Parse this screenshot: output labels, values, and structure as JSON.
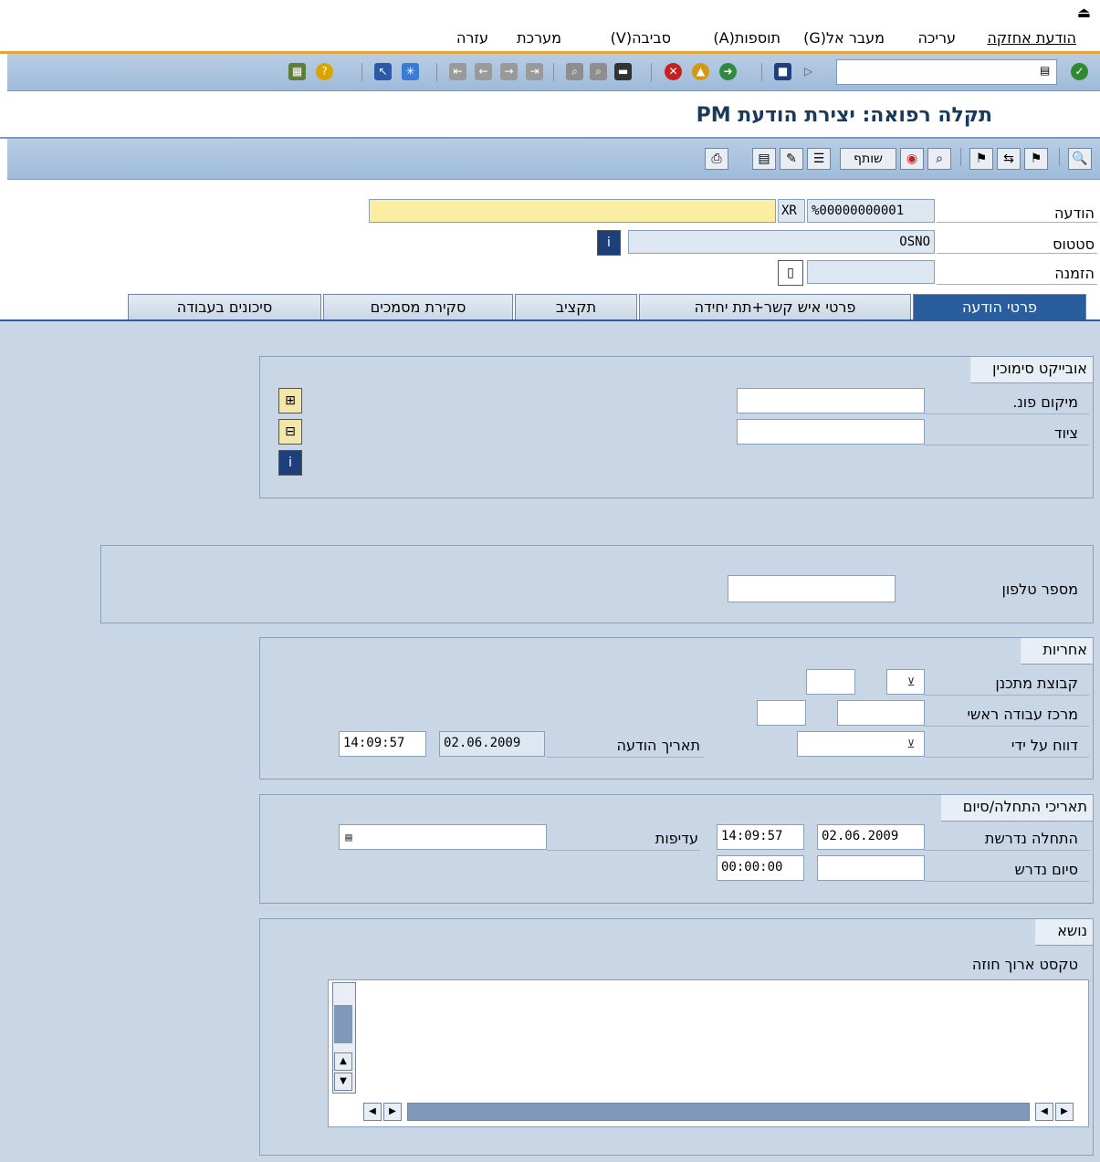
{
  "menu": {
    "items": [
      "הודעת אחזקה",
      "עריכה",
      "מעבר אל(G)",
      "תוספות(A)",
      "סביבה(V)",
      "מערכת",
      "עזרה"
    ],
    "exit_glyph": "⏏"
  },
  "toolbar": {
    "command_value": ""
  },
  "title": {
    "text": "תקלה רפואה: יצירת הודעת PM"
  },
  "app_toolbar": {
    "partner_label": "שותף"
  },
  "header": {
    "notification_label": "הודעה",
    "notification_number": "%00000000001",
    "notification_type": "XR",
    "notification_desc": "",
    "status_label": "סטטוס",
    "status_value": "OSNO",
    "order_label": "הזמנה",
    "order_value": ""
  },
  "tabs": [
    {
      "label": "פרטי הודעה",
      "active": true
    },
    {
      "label": "פרטי איש קשר+תת יחידה",
      "active": false
    },
    {
      "label": "תקציב",
      "active": false
    },
    {
      "label": "סקירת מסמכים",
      "active": false
    },
    {
      "label": "סיכונים בעבודה",
      "active": false
    }
  ],
  "reference_object": {
    "title": "אובייקט סימוכין",
    "func_loc_label": "מיקום פונ.",
    "func_loc_value": "",
    "equipment_label": "ציוד",
    "equipment_value": ""
  },
  "phone": {
    "label": "מספר טלפון",
    "value": ""
  },
  "responsibility": {
    "title": "אחריות",
    "planner_group_label": "קבוצת מתכנן",
    "main_workcenter_label": "מרכז עבודה ראשי",
    "reported_by_label": "דווח על ידי",
    "notif_date_label": "תאריך הודעה",
    "notif_date": "02.06.2009",
    "notif_time": "14:09:57"
  },
  "dates": {
    "title": "תאריכי התחלה/סיום",
    "req_start_label": "התחלה נדרשת",
    "req_start_date": "02.06.2009",
    "req_start_time": "14:09:57",
    "req_end_label": "סיום נדרש",
    "req_end_date": "",
    "req_end_time": "00:00:00",
    "priority_label": "עדיפות",
    "priority_value": ""
  },
  "subject": {
    "title": "נושא",
    "long_text_label": "טקסט ארוך חוזה",
    "long_text_value": ""
  },
  "colors": {
    "accent": "#2a5d9e",
    "tab_body": "#c9d6e5",
    "highlight": "#fbeea3"
  }
}
